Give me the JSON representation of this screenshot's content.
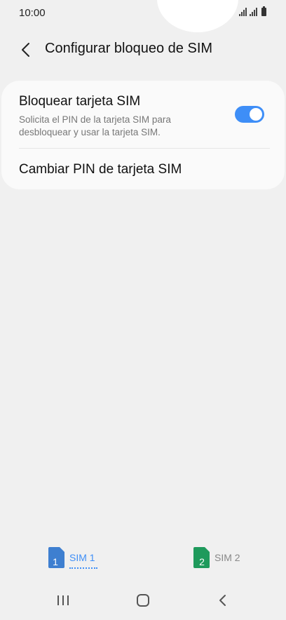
{
  "status_bar": {
    "time": "10:00",
    "icons": [
      "signal-icon",
      "signal-icon",
      "battery-icon"
    ]
  },
  "header": {
    "back_icon": "back-arrow-icon",
    "title": "Configurar bloqueo de SIM"
  },
  "settings": {
    "lock_sim": {
      "title": "Bloquear tarjeta SIM",
      "subtitle": "Solicita el PIN de la tarjeta SIM para desbloquear y usar la tarjeta SIM.",
      "toggle_on": true
    },
    "change_pin": {
      "title": "Cambiar PIN de tarjeta SIM"
    }
  },
  "sim_tabs": [
    {
      "number": "1",
      "label": "SIM 1",
      "selected": true,
      "color": "#3e7fd0"
    },
    {
      "number": "2",
      "label": "SIM 2",
      "selected": false,
      "color": "#1f9a5c"
    }
  ],
  "accent_color": "#3e8ef7",
  "nav_bar": [
    "recent-apps-icon",
    "home-icon",
    "back-icon"
  ]
}
